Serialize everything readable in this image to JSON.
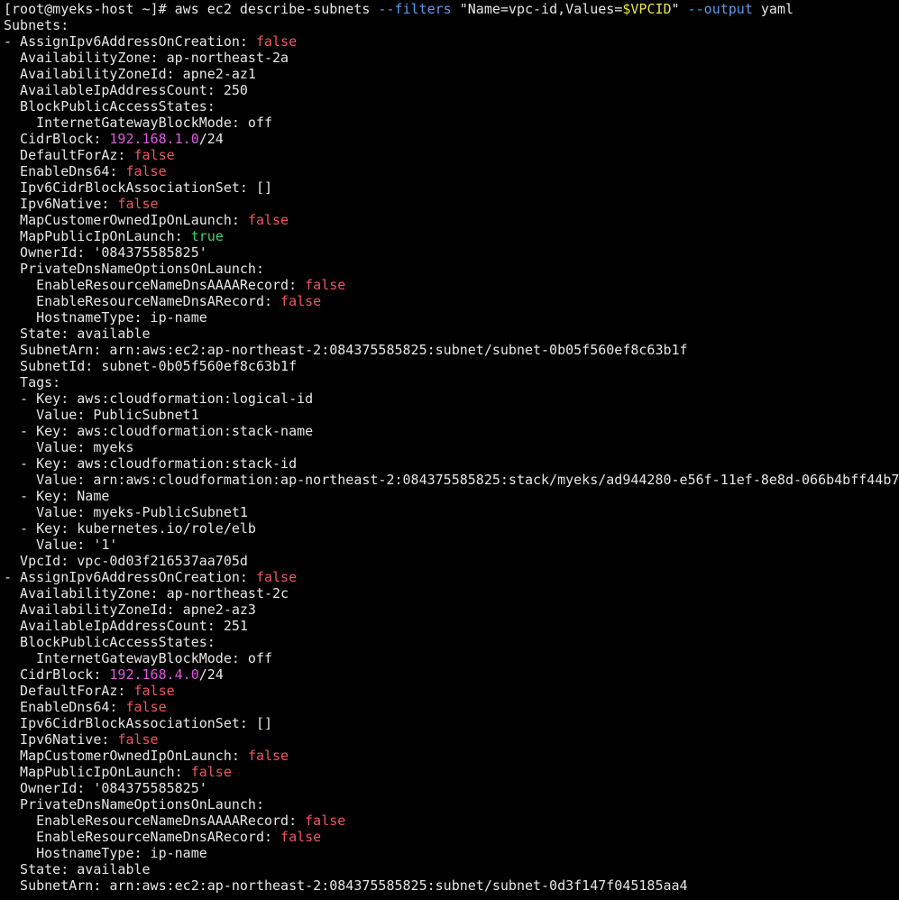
{
  "terminal": {
    "colors": {
      "default": "#e6e6e6",
      "background": "#000000",
      "bool_false": "#f0565f",
      "bool_true": "#3fd46b",
      "ip": "#e556e5",
      "option": "#5a9bf0",
      "string": "#e6e6e6",
      "variable": "#e9e54a"
    },
    "lines": [
      [
        [
          "d",
          "[root@myeks-host ~]# aws ec2 describe-subnets "
        ],
        [
          "o",
          "--filters"
        ],
        [
          "d",
          " \"Name=vpc-id,Values="
        ],
        [
          "v",
          "$VPCID"
        ],
        [
          "d",
          "\" "
        ],
        [
          "o",
          "--output"
        ],
        [
          "d",
          " yaml"
        ]
      ],
      [
        [
          "d",
          "Subnets:"
        ]
      ],
      [
        [
          "d",
          "- AssignIpv6AddressOnCreation: "
        ],
        [
          "f",
          "false"
        ]
      ],
      [
        [
          "d",
          "  AvailabilityZone: ap-northeast-2a"
        ]
      ],
      [
        [
          "d",
          "  AvailabilityZoneId: apne2-az1"
        ]
      ],
      [
        [
          "d",
          "  AvailableIpAddressCount: 250"
        ]
      ],
      [
        [
          "d",
          "  BlockPublicAccessStates:"
        ]
      ],
      [
        [
          "d",
          "    InternetGatewayBlockMode: off"
        ]
      ],
      [
        [
          "d",
          "  CidrBlock: "
        ],
        [
          "i",
          "192.168.1.0"
        ],
        [
          "d",
          "/24"
        ]
      ],
      [
        [
          "d",
          "  DefaultForAz: "
        ],
        [
          "f",
          "false"
        ]
      ],
      [
        [
          "d",
          "  EnableDns64: "
        ],
        [
          "f",
          "false"
        ]
      ],
      [
        [
          "d",
          "  Ipv6CidrBlockAssociationSet: []"
        ]
      ],
      [
        [
          "d",
          "  Ipv6Native: "
        ],
        [
          "f",
          "false"
        ]
      ],
      [
        [
          "d",
          "  MapCustomerOwnedIpOnLaunch: "
        ],
        [
          "f",
          "false"
        ]
      ],
      [
        [
          "d",
          "  MapPublicIpOnLaunch: "
        ],
        [
          "t",
          "true"
        ]
      ],
      [
        [
          "d",
          "  OwnerId: '084375585825'"
        ]
      ],
      [
        [
          "d",
          "  PrivateDnsNameOptionsOnLaunch:"
        ]
      ],
      [
        [
          "d",
          "    EnableResourceNameDnsAAAARecord: "
        ],
        [
          "f",
          "false"
        ]
      ],
      [
        [
          "d",
          "    EnableResourceNameDnsARecord: "
        ],
        [
          "f",
          "false"
        ]
      ],
      [
        [
          "d",
          "    HostnameType: ip-name"
        ]
      ],
      [
        [
          "d",
          "  State: available"
        ]
      ],
      [
        [
          "d",
          "  SubnetArn: arn:aws:ec2:ap-northeast-2:084375585825:subnet/subnet-0b05f560ef8c63b1f"
        ]
      ],
      [
        [
          "d",
          "  SubnetId: subnet-0b05f560ef8c63b1f"
        ]
      ],
      [
        [
          "d",
          "  Tags:"
        ]
      ],
      [
        [
          "d",
          "  - Key: aws:cloudformation:logical-id"
        ]
      ],
      [
        [
          "d",
          "    Value: PublicSubnet1"
        ]
      ],
      [
        [
          "d",
          "  - Key: aws:cloudformation:stack-name"
        ]
      ],
      [
        [
          "d",
          "    Value: myeks"
        ]
      ],
      [
        [
          "d",
          "  - Key: aws:cloudformation:stack-id"
        ]
      ],
      [
        [
          "d",
          "    Value: arn:aws:cloudformation:ap-northeast-2:084375585825:stack/myeks/ad944280-e56f-11ef-8e8d-066b4bff44b7"
        ]
      ],
      [
        [
          "d",
          "  - Key: Name"
        ]
      ],
      [
        [
          "d",
          "    Value: myeks-PublicSubnet1"
        ]
      ],
      [
        [
          "d",
          "  - Key: kubernetes.io/role/elb"
        ]
      ],
      [
        [
          "d",
          "    Value: '1'"
        ]
      ],
      [
        [
          "d",
          "  VpcId: vpc-0d03f216537aa705d"
        ]
      ],
      [
        [
          "d",
          "- AssignIpv6AddressOnCreation: "
        ],
        [
          "f",
          "false"
        ]
      ],
      [
        [
          "d",
          "  AvailabilityZone: ap-northeast-2c"
        ]
      ],
      [
        [
          "d",
          "  AvailabilityZoneId: apne2-az3"
        ]
      ],
      [
        [
          "d",
          "  AvailableIpAddressCount: 251"
        ]
      ],
      [
        [
          "d",
          "  BlockPublicAccessStates:"
        ]
      ],
      [
        [
          "d",
          "    InternetGatewayBlockMode: off"
        ]
      ],
      [
        [
          "d",
          "  CidrBlock: "
        ],
        [
          "i",
          "192.168.4.0"
        ],
        [
          "d",
          "/24"
        ]
      ],
      [
        [
          "d",
          "  DefaultForAz: "
        ],
        [
          "f",
          "false"
        ]
      ],
      [
        [
          "d",
          "  EnableDns64: "
        ],
        [
          "f",
          "false"
        ]
      ],
      [
        [
          "d",
          "  Ipv6CidrBlockAssociationSet: []"
        ]
      ],
      [
        [
          "d",
          "  Ipv6Native: "
        ],
        [
          "f",
          "false"
        ]
      ],
      [
        [
          "d",
          "  MapCustomerOwnedIpOnLaunch: "
        ],
        [
          "f",
          "false"
        ]
      ],
      [
        [
          "d",
          "  MapPublicIpOnLaunch: "
        ],
        [
          "f",
          "false"
        ]
      ],
      [
        [
          "d",
          "  OwnerId: '084375585825'"
        ]
      ],
      [
        [
          "d",
          "  PrivateDnsNameOptionsOnLaunch:"
        ]
      ],
      [
        [
          "d",
          "    EnableResourceNameDnsAAAARecord: "
        ],
        [
          "f",
          "false"
        ]
      ],
      [
        [
          "d",
          "    EnableResourceNameDnsARecord: "
        ],
        [
          "f",
          "false"
        ]
      ],
      [
        [
          "d",
          "    HostnameType: ip-name"
        ]
      ],
      [
        [
          "d",
          "  State: available"
        ]
      ],
      [
        [
          "d",
          "  SubnetArn: arn:aws:ec2:ap-northeast-2:084375585825:subnet/subnet-0d3f147f045185aa4"
        ]
      ]
    ]
  }
}
